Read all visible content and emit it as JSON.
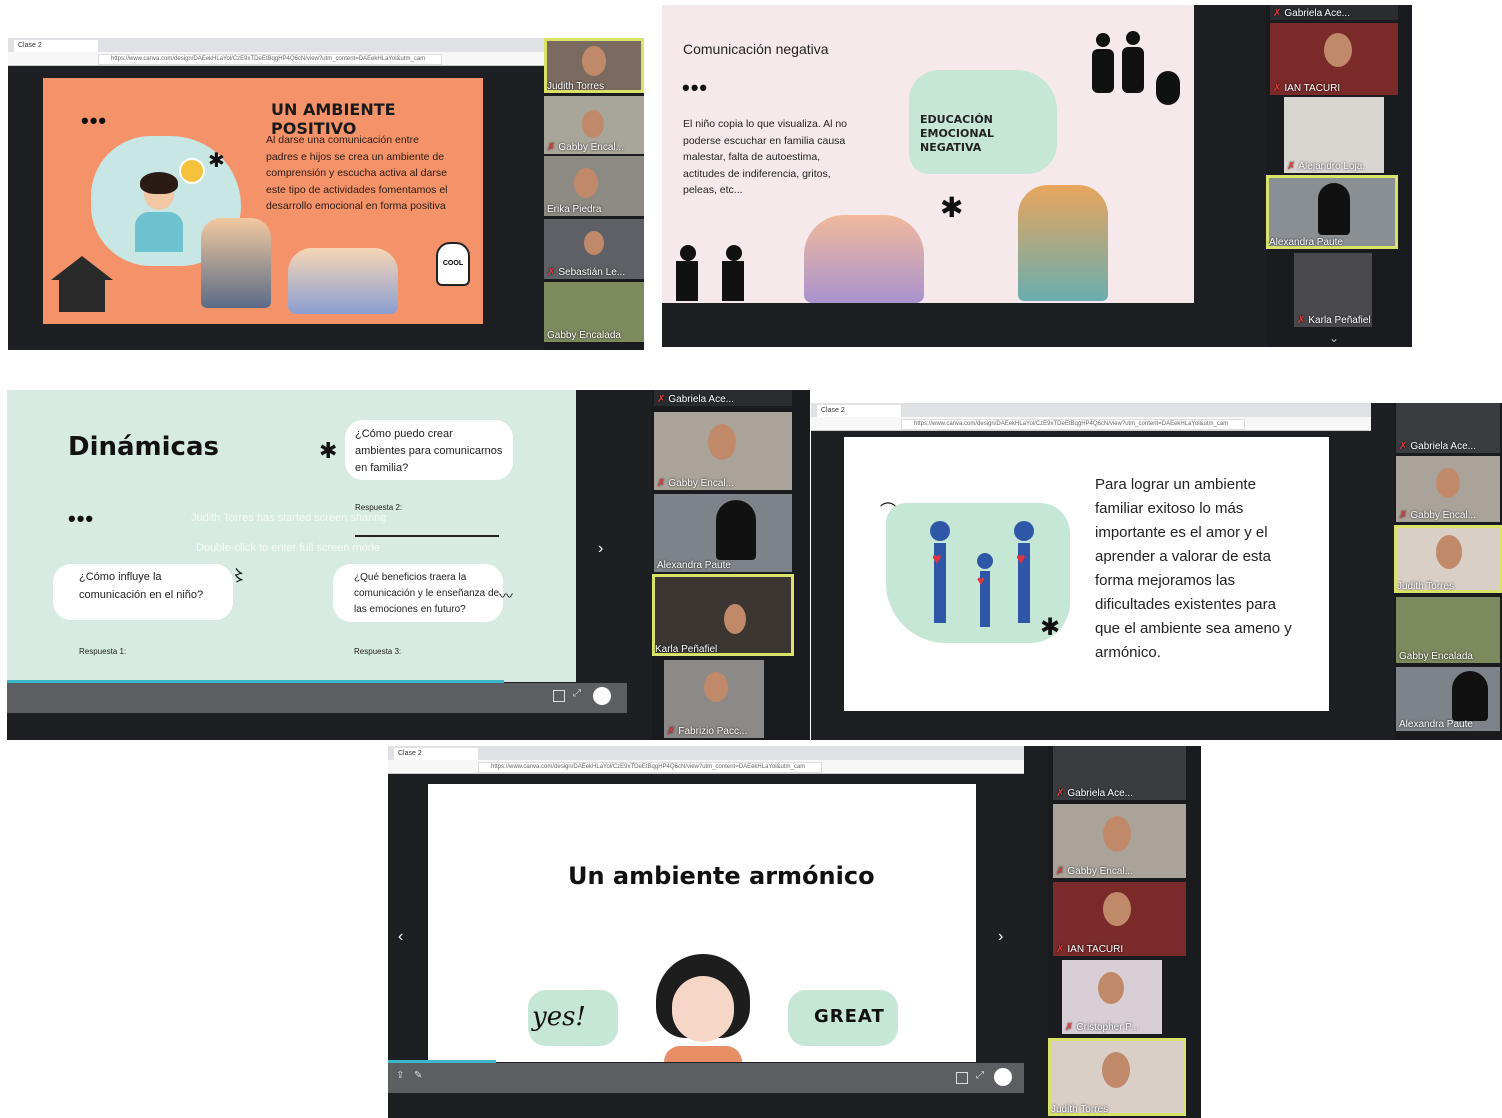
{
  "panels": {
    "p1": {
      "browser_tab": "Clase 2",
      "url": "https://www.canva.com/design/DAEekHLaYol/CzE9xTDeEtBqgHP4Q6cN/view?utm_content=DAEekHLaYol&utm_cam",
      "slide_title": "UN AMBIENTE POSITIVO",
      "slide_dots": "•••",
      "slide_body": "Al darse una comunicación entre padres e hijos se crea un ambiente de comprensión y escucha activa al darse este tipo de actividades fomentamos el desarrollo emocional en forma positiva",
      "cool_label": "COOL",
      "participants": [
        "Judith Torres",
        "Gabby Encal...",
        "Erika Piedra",
        "Sebastián Le...",
        "Gabby Encalada"
      ]
    },
    "p2": {
      "slide_title": "Comunicación negativa",
      "slide_dots": "•••",
      "slide_body": "El niño copia lo que visualiza. Al no poderse escuchar en familia causa malestar, falta de autoestima, actitudes de indiferencia, gritos, peleas, etc...",
      "bubble_title": "EDUCACIÓN EMOCIONAL NEGATIVA",
      "participants": [
        "Gabriela Ace...",
        "IAN TACURI",
        "Alejandro Loja.",
        "Alexandra Paute",
        "Karla Peñafiel"
      ]
    },
    "p3": {
      "slide_title": "Dinámicas",
      "slide_dots": "•••",
      "q1": "¿Cómo puedo crear ambientes para comunicarnos en familia?",
      "q2": "¿Cómo influye la comunicación en el niño?",
      "q3": "¿Qué beneficios traera la comunicación y le enseñanza de las emociones en futuro?",
      "r1": "Respuesta 1:",
      "r2": "Respuesta 2:",
      "r3": "Respuesta 3:",
      "overlay_1": "Judith Torres has started screen sharing",
      "overlay_2": "Double-click to enter full screen mode",
      "next_arrow": "›",
      "participants": [
        "Gabriela Ace...",
        "Gabby Encal...",
        "Alexandra Paute",
        "Karla Peñafiel",
        "Fabrizio Pacc..."
      ]
    },
    "p4": {
      "browser_tab": "Clase 2",
      "url": "https://www.canva.com/design/DAEekHLaYol/CzE9xTDeEtBqgHP4Q6cN/view?utm_content=DAEekHLaYol&utm_cam",
      "slide_body": "Para lograr un ambiente familiar exitoso lo más importante es el amor y el aprender a valorar de esta forma mejoramos las dificultades existentes para que el ambiente sea ameno y armónico.",
      "participants": [
        "Gabriela Ace...",
        "Gabby Encal...",
        "Judith Torres",
        "Gabby Encalada",
        "Alexandra Paute"
      ]
    },
    "p5": {
      "browser_tab": "Clase 2",
      "url": "https://www.canva.com/design/DAEekHLaYol/CzE9xTDeEtBqgHP4Q6cN/view?utm_content=DAEekHLaYol&utm_cam",
      "slide_title": "Un ambiente armónico",
      "yes_label": "yes!",
      "great_label": "GREAT",
      "prev_arrow": "‹",
      "next_arrow": "›",
      "participants": [
        "Gabriela Ace...",
        "Gabby Encal...",
        "IAN TACURI",
        "Cristopher P...",
        "Judith Torres"
      ]
    }
  },
  "colors": {
    "orange_slide": "#f4936a",
    "pink_slide": "#f6e9ec",
    "mint_slide": "#d7ebe2",
    "white_slide": "#ffffff",
    "active_speaker": "#d9e36a",
    "mic_muted": "#e23b3b"
  }
}
